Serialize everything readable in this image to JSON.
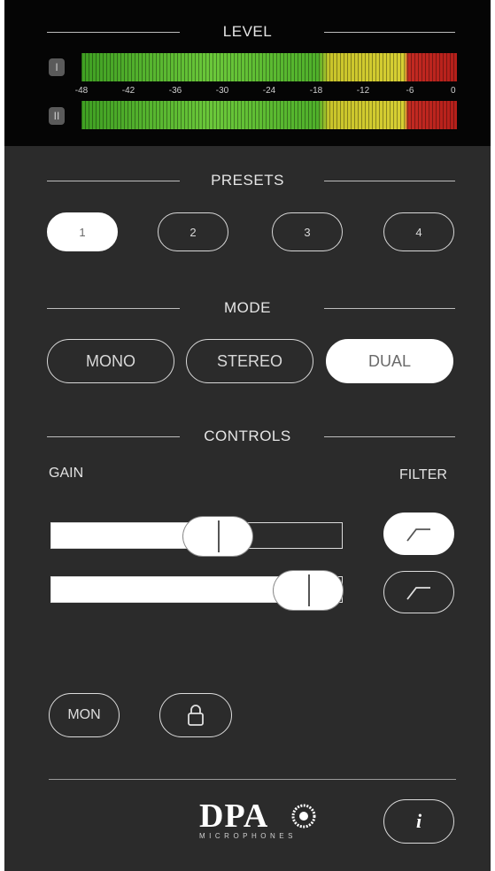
{
  "level": {
    "title": "LEVEL",
    "channels": [
      "I",
      "II"
    ],
    "scale": [
      "-48",
      "-42",
      "-36",
      "-30",
      "-24",
      "-18",
      "-12",
      "-6",
      "0"
    ]
  },
  "presets": {
    "title": "PRESETS",
    "items": [
      "1",
      "2",
      "3",
      "4"
    ],
    "selected": "1"
  },
  "mode": {
    "title": "MODE",
    "items": [
      "MONO",
      "STEREO",
      "DUAL"
    ],
    "selected": "DUAL"
  },
  "controls": {
    "title": "CONTROLS",
    "gain_label": "GAIN",
    "filter_label": "FILTER",
    "gain_levels": [
      0.57,
      0.88
    ],
    "filter_active": [
      true,
      false
    ]
  },
  "bottom": {
    "mon_label": "MON",
    "logo_word": "DPA",
    "logo_sub": "MICROPHONES",
    "info_label": "i"
  },
  "colors": {
    "meter_green": "#4fb02a",
    "meter_yellow": "#d7cf33",
    "meter_red": "#c32a22",
    "background": "#2b2b2b"
  }
}
